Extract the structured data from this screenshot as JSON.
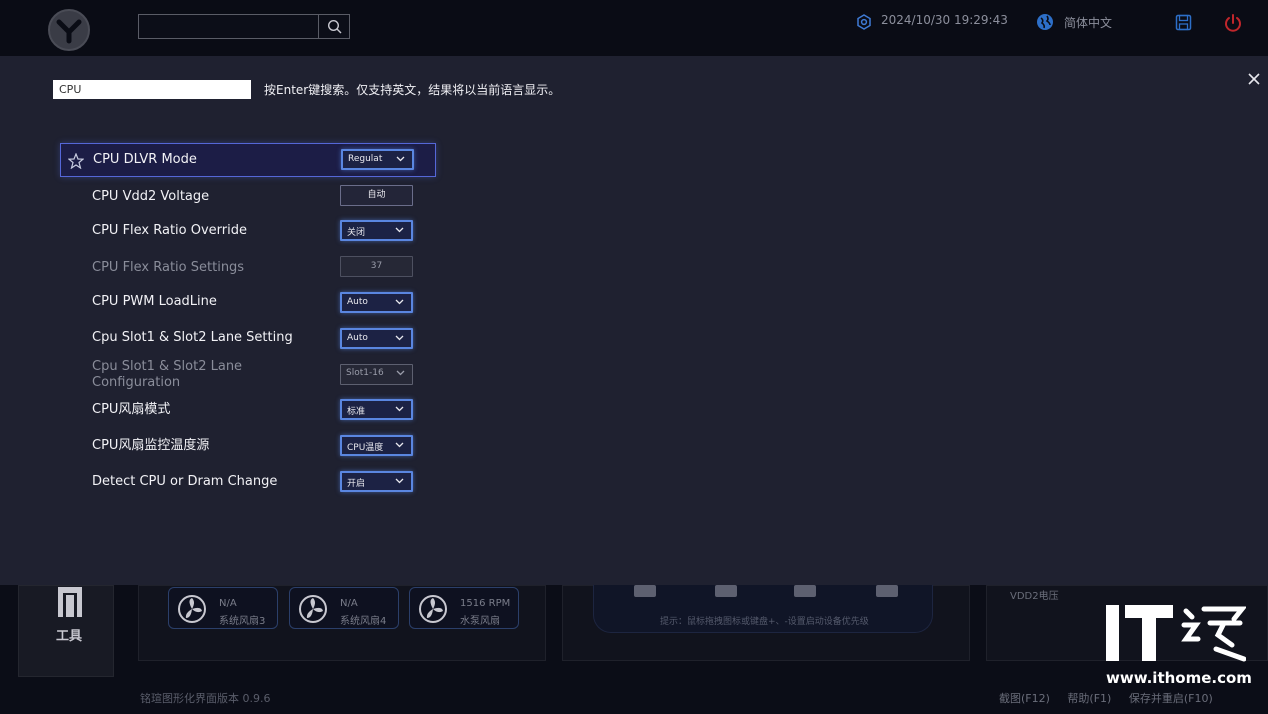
{
  "topbar": {
    "datetime": "2024/10/30 19:29:43",
    "language": "简体中文"
  },
  "search": {
    "value": "CPU",
    "hint": "按Enter键搜索。仅支持英文，结果将以当前语言显示。"
  },
  "settings": [
    {
      "label": "CPU DLVR Mode",
      "value": "Regulat",
      "control": "dropdown",
      "enabled": true,
      "selected": true
    },
    {
      "label": "CPU Vdd2 Voltage",
      "value": "自动",
      "control": "text",
      "enabled": true
    },
    {
      "label": "CPU Flex Ratio Override",
      "value": "关闭",
      "control": "dropdown",
      "enabled": true
    },
    {
      "label": "CPU Flex Ratio Settings",
      "value": "37",
      "control": "text",
      "enabled": false
    },
    {
      "label": "CPU PWM LoadLine",
      "value": "Auto",
      "control": "dropdown",
      "enabled": true
    },
    {
      "label": "Cpu Slot1 & Slot2 Lane Setting",
      "value": "Auto",
      "control": "dropdown",
      "enabled": true
    },
    {
      "label": "Cpu Slot1 & Slot2 Lane Configuration",
      "value": "Slot1-16",
      "control": "dropdown",
      "enabled": false
    },
    {
      "label": "CPU风扇模式",
      "value": "标准",
      "control": "dropdown",
      "enabled": true
    },
    {
      "label": "CPU风扇监控温度源",
      "value": "CPU温度",
      "control": "dropdown",
      "enabled": true
    },
    {
      "label": "Detect CPU or Dram Change",
      "value": "开启",
      "control": "dropdown",
      "enabled": true
    }
  ],
  "background": {
    "tools_label": "工具",
    "fans": [
      {
        "value": "N/A",
        "name": "系统风扇3"
      },
      {
        "value": "N/A",
        "name": "系统风扇4"
      },
      {
        "value": "1516 RPM",
        "name": "水泵风扇"
      }
    ],
    "boot_hint": "提示：鼠标拖拽图标或键盘+、-设置启动设备优先级",
    "voltage_label": "VDD2电压",
    "version": "铭瑄图形化界面版本 0.9.6",
    "footer": [
      "截图(F12)",
      "帮助(F1)",
      "保存并重启(F10)"
    ]
  },
  "watermark": {
    "url": "www.ithome.com"
  },
  "colors": {
    "accent": "#5a86e0",
    "selected_row": "#5567d8",
    "overlay_bg": "#1f2130",
    "power": "#c0262b"
  }
}
